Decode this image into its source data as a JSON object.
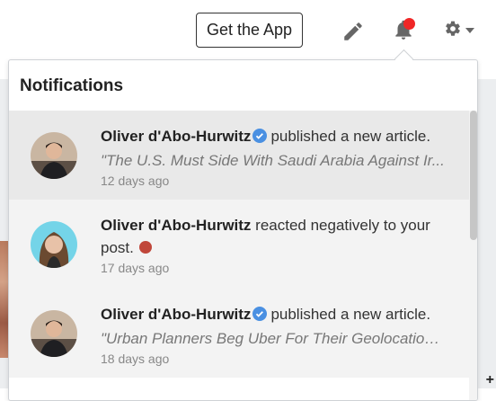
{
  "header": {
    "get_app_label": "Get the App",
    "icons": {
      "pencil": "pencil-icon",
      "bell": "bell-icon",
      "gear": "gear-icon"
    },
    "notification_dot_color": "#f02626"
  },
  "notifications": {
    "title": "Notifications",
    "items": [
      {
        "name": "Oliver d'Abo-Hurwitz",
        "verified": true,
        "action": "published a new article.",
        "excerpt": "\"The U.S. Must Side With Saudi Arabia Against Ir...",
        "time": "12 days ago"
      },
      {
        "name": "Oliver d'Abo-Hurwitz",
        "verified": false,
        "action": "reacted negatively to your post.",
        "reaction_color": "#c0463a",
        "time": "17 days ago"
      },
      {
        "name": "Oliver d'Abo-Hurwitz",
        "verified": true,
        "action": "published a new article.",
        "excerpt": "\"Urban Planners Beg Uber For Their Geolocation ...",
        "time": "18 days ago"
      }
    ]
  },
  "colors": {
    "verified": "#4a90e2",
    "active_row": "#e9e9e9"
  }
}
